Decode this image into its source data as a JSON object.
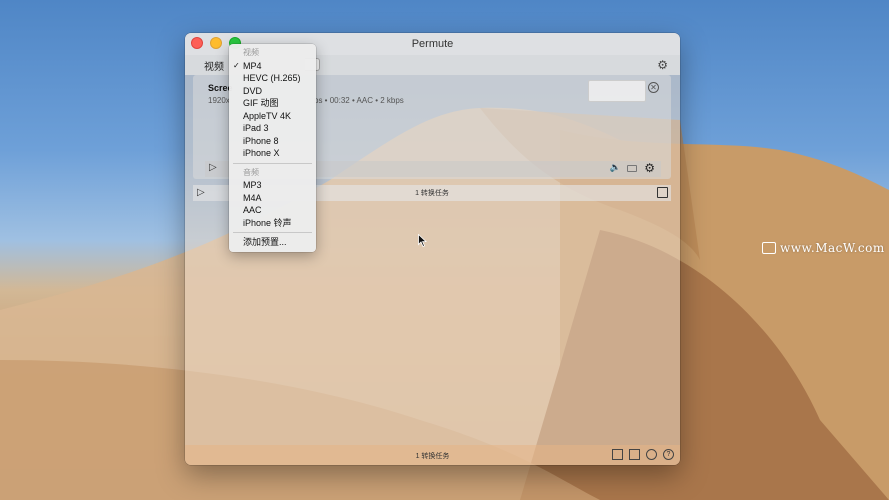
{
  "window": {
    "title": "Permute"
  },
  "toolbar": {
    "format_label": "视频"
  },
  "item": {
    "file_name": "Scree",
    "meta_left": "1920x",
    "meta_right": "ps • 00:32 • AAC • 2 kbps"
  },
  "queue": {
    "count_label": "1 转换任务"
  },
  "status": {
    "count_label": "1 转换任务"
  },
  "menu": {
    "video_header": "视频",
    "video_items": [
      {
        "label": "MP4",
        "checked": true
      },
      {
        "label": "HEVC (H.265)",
        "checked": false
      },
      {
        "label": "DVD",
        "checked": false
      },
      {
        "label": "GIF 动图",
        "checked": false
      },
      {
        "label": "AppleTV 4K",
        "checked": false
      },
      {
        "label": "iPad 3",
        "checked": false
      },
      {
        "label": "iPhone 8",
        "checked": false
      },
      {
        "label": "iPhone X",
        "checked": false
      }
    ],
    "audio_header": "音频",
    "audio_items": [
      {
        "label": "MP3"
      },
      {
        "label": "M4A"
      },
      {
        "label": "AAC"
      },
      {
        "label": "iPhone 铃声"
      }
    ],
    "add_preset": "添加预置..."
  },
  "watermark": {
    "text": "www.MacW.com"
  },
  "colors": {
    "close": "#fd5f57",
    "minimize": "#febc2e",
    "maximize": "#28c840"
  }
}
